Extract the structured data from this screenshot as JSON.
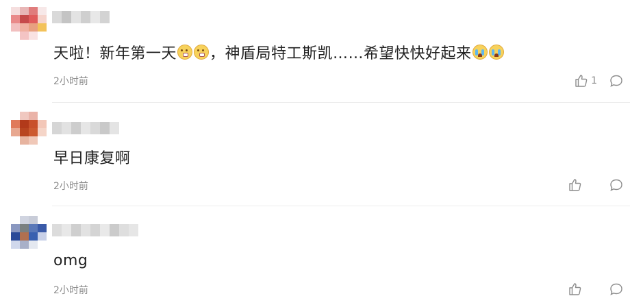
{
  "comments": [
    {
      "text_before": "天啦！新年第一天",
      "emojis_mid": [
        "surprised-face-emoji",
        "surprised-face-emoji"
      ],
      "text_after": "，神盾局特工斯凯……希望快快好起来",
      "emojis_end": [
        "crying-face-emoji",
        "crying-face-emoji"
      ],
      "time": "2小时前",
      "like_count": "1"
    },
    {
      "text": "早日康复啊",
      "time": "2小时前",
      "like_count": ""
    },
    {
      "text": "omg",
      "time": "2小时前",
      "like_count": ""
    }
  ],
  "icons": {
    "like": "thumbs-up-icon",
    "reply": "comment-bubble-icon"
  },
  "colors": {
    "text": "#222222",
    "meta": "#8c8c8c",
    "divider": "#ececec"
  }
}
